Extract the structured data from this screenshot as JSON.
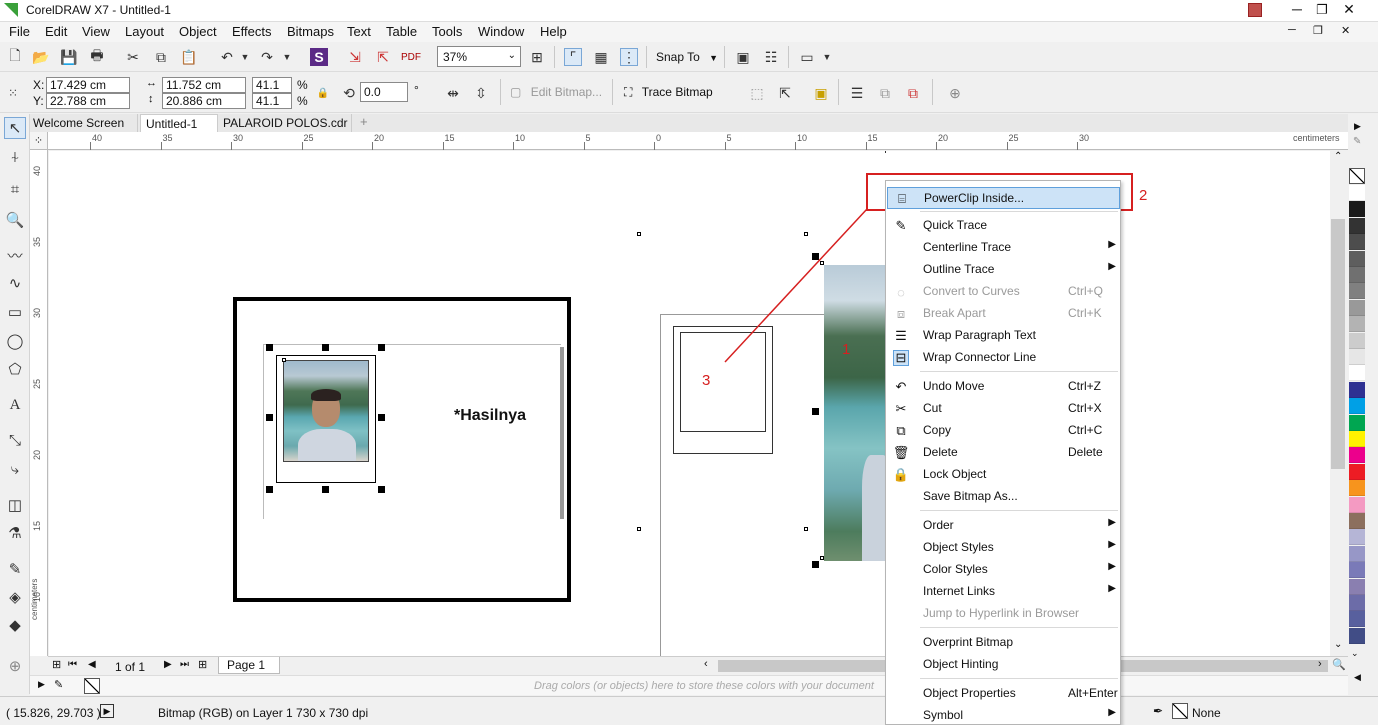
{
  "app": {
    "title": "CorelDRAW X7 - Untitled-1"
  },
  "menubar": [
    "File",
    "Edit",
    "View",
    "Layout",
    "Object",
    "Effects",
    "Bitmaps",
    "Text",
    "Table",
    "Tools",
    "Window",
    "Help"
  ],
  "toolbar": {
    "zoom": "37%",
    "snap_to": "Snap To"
  },
  "propbar": {
    "x": "17.429 cm",
    "y": "22.788 cm",
    "w": "11.752 cm",
    "h": "20.886 cm",
    "sx": "41.1",
    "sy": "41.1",
    "pct1": "%",
    "pct2": "%",
    "angle": "0.0",
    "deg": "°",
    "edit_bitmap": "Edit Bitmap...",
    "trace_bitmap": "Trace Bitmap"
  },
  "tabs": [
    "Welcome Screen",
    "Untitled-1",
    "PALAROID POLOS.cdr"
  ],
  "ruler": {
    "unit": "centimeters",
    "h_ticks": [
      "40",
      "35",
      "30",
      "25",
      "20",
      "15",
      "10",
      "5",
      "0",
      "5",
      "10",
      "15",
      "20",
      "25",
      "30"
    ],
    "v_ticks": [
      "40",
      "35",
      "30",
      "25",
      "20",
      "15",
      "10"
    ]
  },
  "canvas": {
    "caption": "*Hasilnya",
    "ann1": "1",
    "ann2": "2",
    "ann3": "3"
  },
  "context_menu": [
    {
      "label": "PowerClip Inside...",
      "icon": "powerclip-icon",
      "highlight": true
    },
    {
      "label": "Quick Trace",
      "icon": "quick-trace-icon"
    },
    {
      "label": "Centerline Trace",
      "submenu": true
    },
    {
      "label": "Outline Trace",
      "submenu": true
    },
    {
      "label": "Convert to Curves",
      "shortcut": "Ctrl+Q",
      "disabled": true,
      "icon": "convert-curves-icon"
    },
    {
      "label": "Break Apart",
      "shortcut": "Ctrl+K",
      "disabled": true,
      "icon": "break-apart-icon"
    },
    {
      "label": "Wrap Paragraph Text",
      "icon": "wrap-text-icon"
    },
    {
      "label": "Wrap Connector Line",
      "icon": "wrap-connector-icon"
    },
    {
      "label": "Undo Move",
      "shortcut": "Ctrl+Z",
      "icon": "undo-icon"
    },
    {
      "label": "Cut",
      "shortcut": "Ctrl+X",
      "icon": "scissors-icon"
    },
    {
      "label": "Copy",
      "shortcut": "Ctrl+C",
      "icon": "copy-icon"
    },
    {
      "label": "Delete",
      "shortcut": "Delete",
      "icon": "trash-icon"
    },
    {
      "label": "Lock Object",
      "icon": "lock-icon"
    },
    {
      "label": "Save Bitmap As..."
    },
    {
      "label": "Order",
      "submenu": true
    },
    {
      "label": "Object Styles",
      "submenu": true
    },
    {
      "label": "Color Styles",
      "submenu": true
    },
    {
      "label": "Internet Links",
      "submenu": true
    },
    {
      "label": "Jump to Hyperlink in Browser",
      "disabled": true
    },
    {
      "label": "Overprint Bitmap"
    },
    {
      "label": "Object Hinting"
    },
    {
      "label": "Object Properties",
      "shortcut": "Alt+Enter"
    },
    {
      "label": "Symbol",
      "submenu": true
    }
  ],
  "page_nav": {
    "count": "1 of 1",
    "page": "Page 1"
  },
  "palette_hint": "Drag colors (or objects) here to store these colors with your document",
  "status": {
    "coords": "( 15.826, 29.703 )",
    "info": "Bitmap (RGB) on Layer 1 730 x 730 dpi",
    "fill": "None"
  },
  "palette_colors": [
    "#ffffff",
    "#1a1a1a",
    "#333333",
    "#4d4d4d",
    "#5e5e5e",
    "#707070",
    "#808080",
    "#999999",
    "#b3b3b3",
    "#cccccc",
    "#e6e6e6",
    "#ffffff",
    "#2e3192",
    "#00a0e6",
    "#00a651",
    "#fff200",
    "#ec008c",
    "#ed1c24",
    "#f7941d",
    "#f49ac2",
    "#8c6f5e",
    "#b5b5d6",
    "#9797c7",
    "#7a7ab8",
    "#8a7fb0",
    "#6c6ca8",
    "#58609e",
    "#414d86"
  ]
}
